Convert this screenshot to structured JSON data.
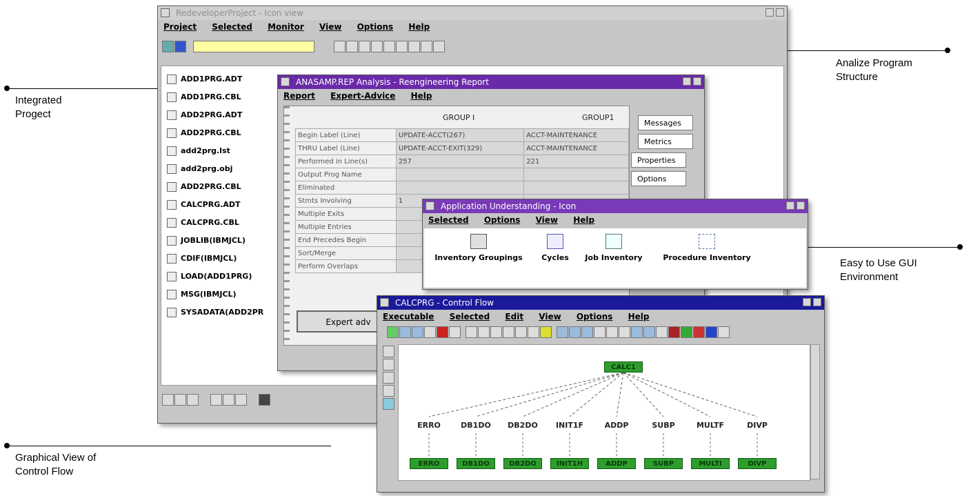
{
  "annotations": {
    "analize": [
      "Analize Program",
      "Structure"
    ],
    "integrated": [
      "Integrated",
      "Progect"
    ],
    "easy_gui": [
      "Easy to Use GUI",
      "Environment"
    ],
    "graphical": [
      "Graphical View of",
      "Control Flow"
    ]
  },
  "main_window": {
    "title": "RedeveloperProject - Icon view",
    "menu": [
      "Project",
      "Selected",
      "Monitor",
      "View",
      "Options",
      "Help"
    ],
    "files": [
      "ADD1PRG.ADT",
      "ADD1PRG.CBL",
      "ADD2PRG.ADT",
      "ADD2PRG.CBL",
      "add2prg.lst",
      "add2prg.obj",
      "ADD2PRG.CBL",
      "CALCPRG.ADT",
      "CALCPRG.CBL",
      "JOBLIB(IBMJCL)",
      "CDIF(IBMJCL)",
      "LOAD(ADD1PRG)",
      "MSG(IBMJCL)",
      "SYSADATA(ADD2PR"
    ]
  },
  "analysis_window": {
    "title": "ANASAMP.REP Analysis - Reengineering Report",
    "menu": [
      "Report",
      "Expert-Advice",
      "Help"
    ],
    "headers": [
      "GROUP I",
      "GROUP1"
    ],
    "rows": [
      {
        "label": "Begin Label (Line)",
        "v1": "UPDATE-ACCT(267)",
        "v2": "ACCT-MAINTENANCE"
      },
      {
        "label": "THRU Label (Line)",
        "v1": "UPDATE-ACCT-EXIT(329)",
        "v2": "ACCT-MAINTENANCE"
      },
      {
        "label": "Performed in Line(s)",
        "v1": "257",
        "v2": "221"
      },
      {
        "label": "Output Prog Name",
        "v1": "",
        "v2": ""
      },
      {
        "label": "Eliminated",
        "v1": "",
        "v2": ""
      },
      {
        "label": "Stmts Involving",
        "v1": "1",
        "v2": ""
      },
      {
        "label": "Multiple Exits",
        "v1": "",
        "v2": ""
      },
      {
        "label": "Multiple Entries",
        "v1": "",
        "v2": ""
      },
      {
        "label": "End Precedes Begin",
        "v1": "",
        "v2": ""
      },
      {
        "label": "Sort/Merge",
        "v1": "",
        "v2": ""
      },
      {
        "label": "Perform Overlaps",
        "v1": "",
        "v2": ""
      }
    ],
    "tabs": [
      "Messages",
      "Metrics",
      "Properties",
      "Options"
    ],
    "expert_button": "Expert adv"
  },
  "app_window": {
    "title": "Application Understanding - Icon",
    "menu": [
      "Selected",
      "Options",
      "View",
      "Help"
    ],
    "icons": [
      "Inventory Groupings",
      "Cycles",
      "Job Inventory",
      "Procedure Inventory"
    ]
  },
  "flow_window": {
    "title": "CALCPRG - Control Flow",
    "menu": [
      "Executable",
      "Selected",
      "Edit",
      "View",
      "Options",
      "Help"
    ],
    "root": "CALC1",
    "children": [
      "ERRO",
      "DB1DO",
      "DB2DO",
      "INIT1F",
      "ADDP",
      "SUBP",
      "MULTF",
      "DIVP"
    ],
    "leaves": [
      "ERRO",
      "DB1DO",
      "DB2DO",
      "INIT1H",
      "ADDP",
      "SUBP",
      "MULTI",
      "DIVP"
    ]
  },
  "colors": {
    "purple_title": "#6a2aa8",
    "navy_title": "#1a1a9a",
    "node_green": "#2e9d2e",
    "input_yellow": "#ffffa0"
  }
}
